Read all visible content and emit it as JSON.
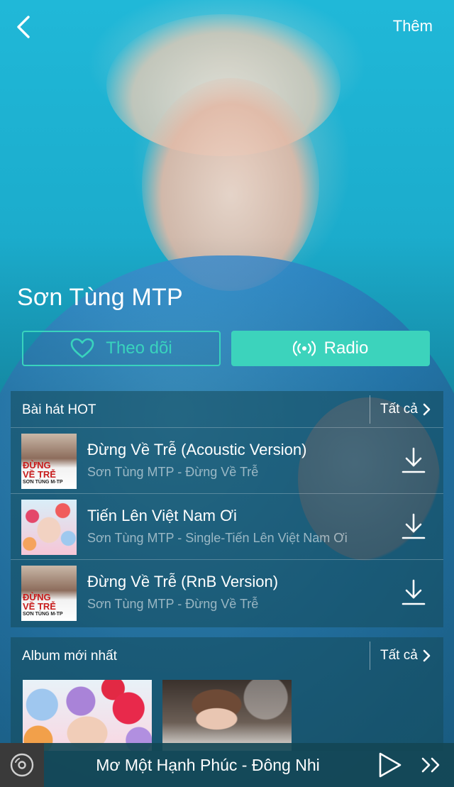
{
  "header": {
    "back_icon": "chevron-left-icon",
    "more_label": "Thêm"
  },
  "artist": {
    "name": "Sơn Tùng MTP"
  },
  "actions": {
    "follow_label": "Theo dõi",
    "follow_icon": "heart-outline-icon",
    "radio_label": "Radio",
    "radio_icon": "radio-broadcast-icon"
  },
  "hot_songs": {
    "title": "Bài hát HOT",
    "see_all_label": "Tất cả",
    "items": [
      {
        "title": "Đừng Về Trễ (Acoustic Version)",
        "subtitle": "Sơn Tùng MTP - Đừng Về Trễ",
        "thumb_caption_top": "ĐỪNG",
        "thumb_caption_mid": "VỀ TRỄ",
        "thumb_caption_bottom": "SƠN TÙNG M-TP"
      },
      {
        "title": "Tiến Lên Việt Nam Ơi",
        "subtitle": "Sơn Tùng MTP - Single-Tiến Lên Việt Nam Ơi"
      },
      {
        "title": "Đừng Về Trễ (RnB Version)",
        "subtitle": "Sơn Tùng MTP - Đừng Về Trễ",
        "thumb_caption_top": "ĐỪNG",
        "thumb_caption_mid": "VỀ TRỄ",
        "thumb_caption_bottom": "SƠN TÙNG M-TP"
      }
    ]
  },
  "albums": {
    "title": "Album mới nhất",
    "see_all_label": "Tất cả"
  },
  "player": {
    "now_playing": "Mơ Một Hạnh Phúc - Đông Nhi"
  },
  "colors": {
    "accent": "#3cd3bc",
    "background": "#1aa9c9"
  }
}
